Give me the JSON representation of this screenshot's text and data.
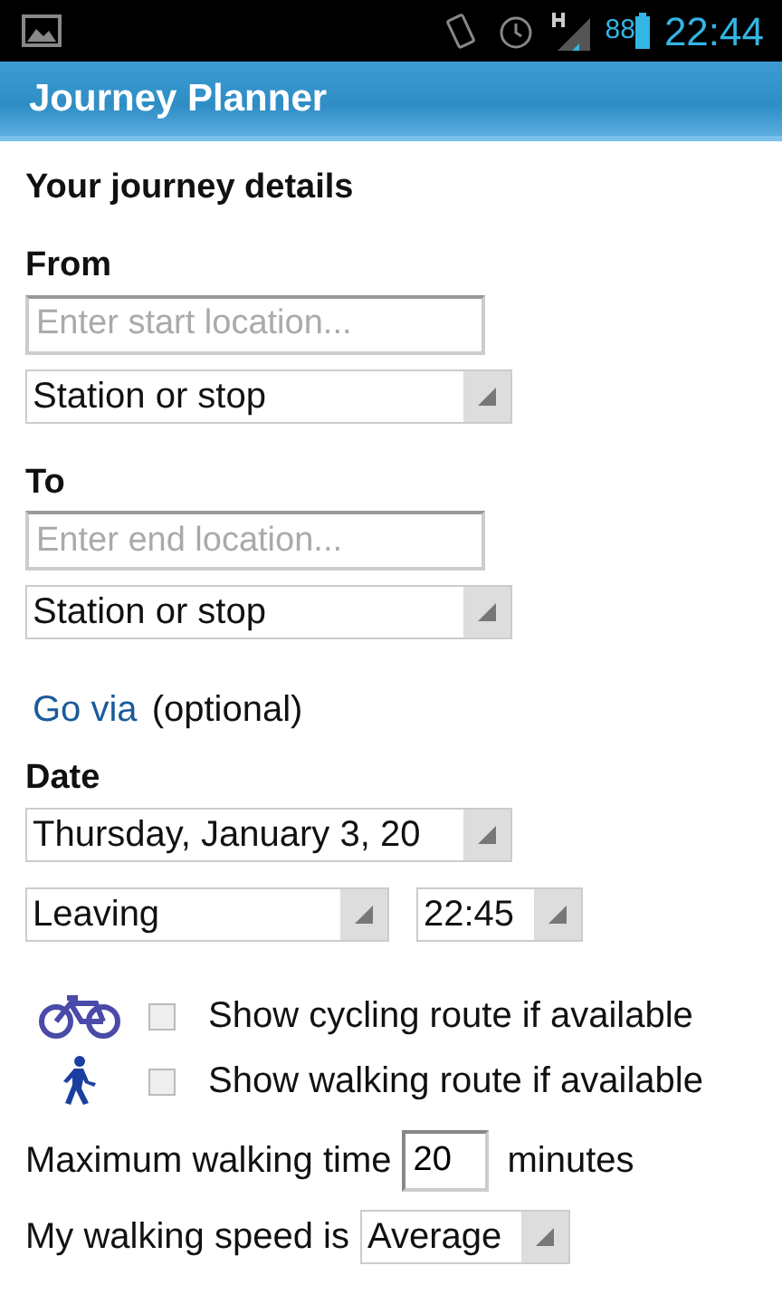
{
  "status_bar": {
    "battery": "88",
    "time": "22:44"
  },
  "app_bar": {
    "title": "Journey Planner"
  },
  "section_title": "Your journey details",
  "from": {
    "label": "From",
    "placeholder": "Enter start location...",
    "type_value": "Station or stop"
  },
  "to": {
    "label": "To",
    "placeholder": "Enter end location...",
    "type_value": "Station or stop"
  },
  "go_via": {
    "link": "Go via",
    "note": "(optional)"
  },
  "date": {
    "label": "Date",
    "value": "Thursday, January 3, 20",
    "mode": "Leaving",
    "time": "22:45"
  },
  "options": [
    {
      "kind": "cycling",
      "label": "Show cycling route if available",
      "checked": false
    },
    {
      "kind": "walking",
      "label": "Show walking route if available",
      "checked": false
    }
  ],
  "max_walking": {
    "label": "Maximum walking time",
    "value": "20",
    "unit": "minutes"
  },
  "walking_speed": {
    "label": "My walking speed is",
    "value": "Average"
  }
}
